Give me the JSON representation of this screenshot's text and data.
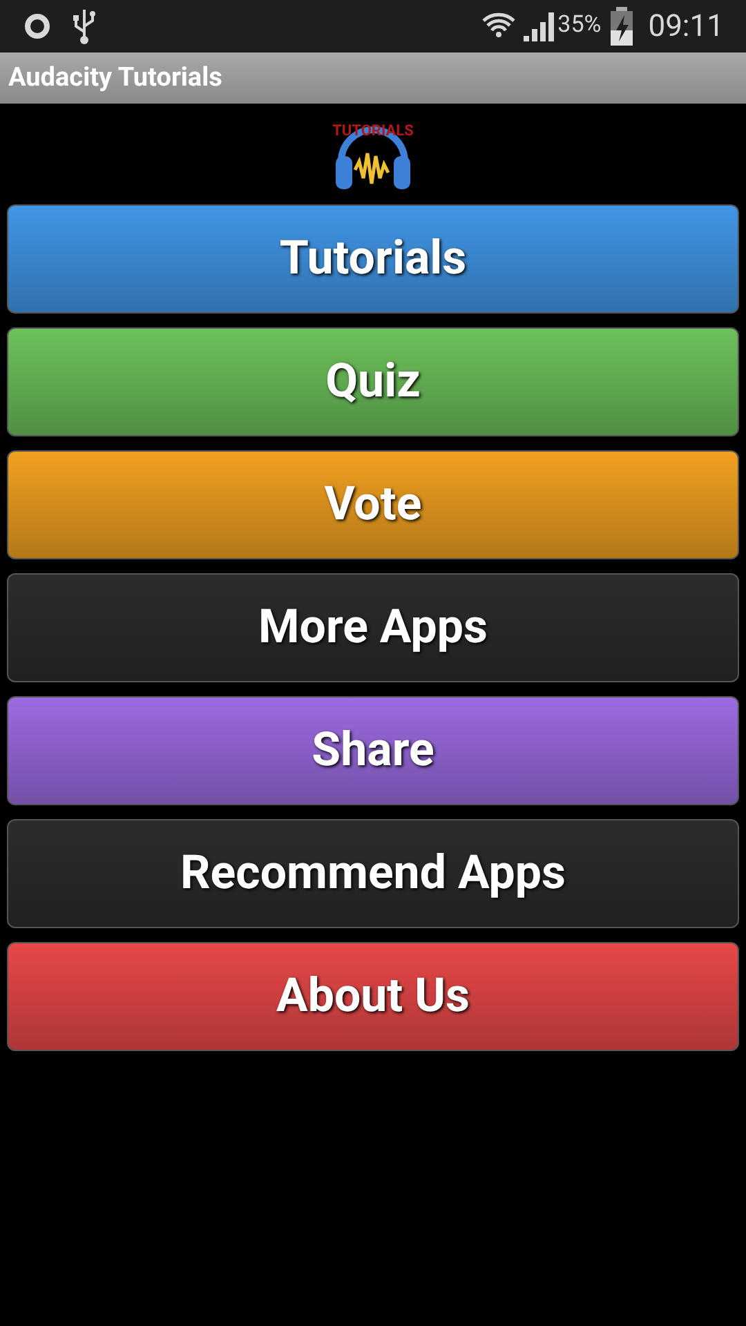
{
  "status_bar": {
    "battery": "35%",
    "time": "09:11"
  },
  "title_bar": {
    "title": "Audacity Tutorials"
  },
  "logo": {
    "text": "TUTORIALS"
  },
  "menu_buttons": [
    {
      "label": "Tutorials",
      "color": "#4196e6"
    },
    {
      "label": "Quiz",
      "color": "#6cc05a"
    },
    {
      "label": "Vote",
      "color": "#f0a020"
    },
    {
      "label": "More Apps",
      "color": "#2c2c2c"
    },
    {
      "label": "Share",
      "color": "#9b6be0"
    },
    {
      "label": "Recommend Apps",
      "color": "#2c2c2c"
    },
    {
      "label": "About Us",
      "color": "#e84848"
    }
  ]
}
